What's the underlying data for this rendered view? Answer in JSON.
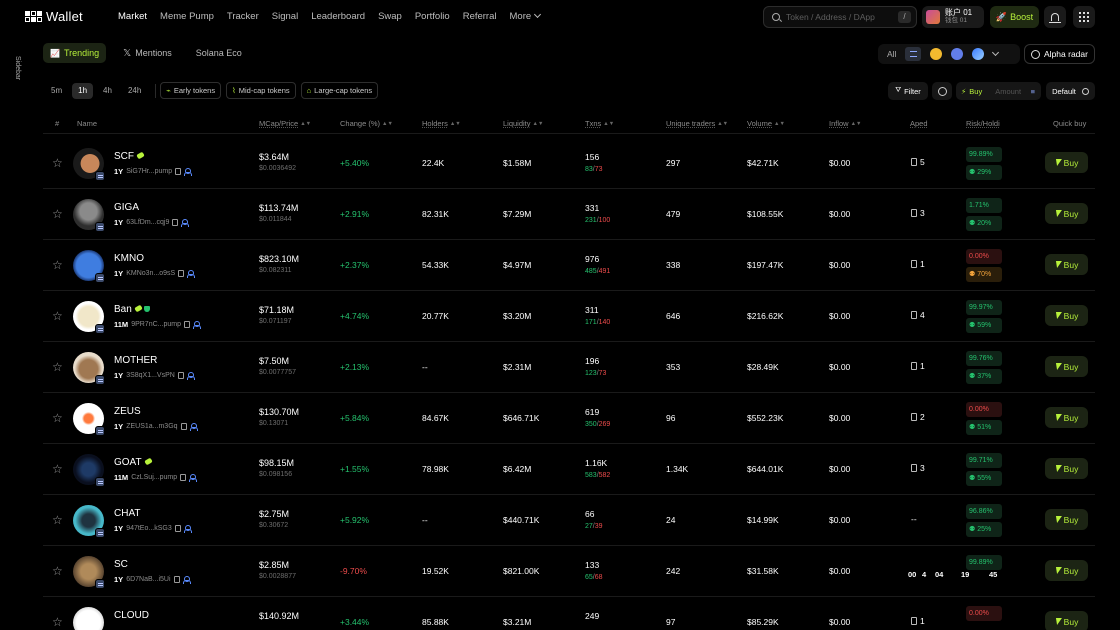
{
  "brand": {
    "logo_text": "Wallet"
  },
  "nav": [
    "Market",
    "Meme Pump",
    "Tracker",
    "Signal",
    "Leaderboard",
    "Swap",
    "Portfolio",
    "Referral",
    "More"
  ],
  "nav_active": "Market",
  "search": {
    "placeholder": "Token / Address / DApp",
    "shortcut": "/"
  },
  "account": {
    "name": "账户 01",
    "sub": "钱包 01"
  },
  "boost_label": "Boost",
  "sidebar_label": "Sidebar",
  "tabs": [
    "Trending",
    "Mentions",
    "Solana Eco"
  ],
  "chain_filter": {
    "all": "All"
  },
  "alpha_radar": "Alpha radar",
  "timeframes": [
    "5m",
    "1h",
    "4h",
    "24h"
  ],
  "timeframe_active": "1h",
  "chips": [
    "Early tokens",
    "Mid-cap tokens",
    "Large-cap tokens"
  ],
  "controls": {
    "filter": "Filter",
    "buy": "Buy",
    "amount": "Amount",
    "default": "Default"
  },
  "columns": [
    "#",
    "Name",
    "MCap/Price",
    "Change (%)",
    "Holders",
    "Liquidity",
    "Txns",
    "Unique traders",
    "Volume",
    "Inflow",
    "Aped",
    "Risk/Holdi",
    "Quick buy"
  ],
  "buy_label": "Buy",
  "rows": [
    {
      "name": "SCF",
      "age": "1Y",
      "addr": "SiG7Hr...pump",
      "mcap": "$3.64M",
      "price": "$0.0036492",
      "change": "+5.40%",
      "holders": "22.4K",
      "liquidity": "$1.58M",
      "txns": "156",
      "buys": "83",
      "sells": "73",
      "traders": "297",
      "volume": "$42.71K",
      "inflow": "$0.00",
      "aped": "5",
      "risk1": "99.89%",
      "risk2": "29%",
      "risk1_color": "g",
      "risk2_color": "g",
      "tags": [
        "pill"
      ]
    },
    {
      "name": "GIGA",
      "age": "1Y",
      "addr": "63LfDm...cqj9",
      "mcap": "$113.74M",
      "price": "$0.011844",
      "change": "+2.91%",
      "holders": "82.31K",
      "liquidity": "$7.29M",
      "txns": "331",
      "buys": "231",
      "sells": "100",
      "traders": "479",
      "volume": "$108.55K",
      "inflow": "$0.00",
      "aped": "3",
      "risk1": "1.71%",
      "risk2": "20%",
      "risk1_color": "g",
      "risk2_color": "g",
      "tags": []
    },
    {
      "name": "KMNO",
      "age": "1Y",
      "addr": "KMNo3n...o9sS",
      "mcap": "$823.10M",
      "price": "$0.082311",
      "change": "+2.37%",
      "holders": "54.33K",
      "liquidity": "$4.97M",
      "txns": "976",
      "buys": "485",
      "sells": "491",
      "traders": "338",
      "volume": "$197.47K",
      "inflow": "$0.00",
      "aped": "1",
      "risk1": "0.00%",
      "risk2": "70%",
      "risk1_color": "r",
      "risk2_color": "o",
      "tags": []
    },
    {
      "name": "Ban",
      "age": "11M",
      "addr": "9PR7nC...pump",
      "mcap": "$71.18M",
      "price": "$0.071197",
      "change": "+4.74%",
      "holders": "20.77K",
      "liquidity": "$3.20M",
      "txns": "311",
      "buys": "171",
      "sells": "140",
      "traders": "646",
      "volume": "$216.62K",
      "inflow": "$0.00",
      "aped": "4",
      "risk1": "99.97%",
      "risk2": "59%",
      "risk1_color": "g",
      "risk2_color": "g",
      "tags": [
        "pill",
        "shield"
      ]
    },
    {
      "name": "MOTHER",
      "age": "1Y",
      "addr": "3S8qX1...VsPN",
      "mcap": "$7.50M",
      "price": "$0.0077757",
      "change": "+2.13%",
      "holders": "--",
      "liquidity": "$2.31M",
      "txns": "196",
      "buys": "123",
      "sells": "73",
      "traders": "353",
      "volume": "$28.49K",
      "inflow": "$0.00",
      "aped": "1",
      "risk1": "99.76%",
      "risk2": "37%",
      "risk1_color": "g",
      "risk2_color": "g",
      "tags": []
    },
    {
      "name": "ZEUS",
      "age": "1Y",
      "addr": "ZEUS1a...m3Gq",
      "mcap": "$130.70M",
      "price": "$0.13071",
      "change": "+5.84%",
      "holders": "84.67K",
      "liquidity": "$646.71K",
      "txns": "619",
      "buys": "350",
      "sells": "269",
      "traders": "96",
      "volume": "$552.23K",
      "inflow": "$0.00",
      "aped": "2",
      "risk1": "0.00%",
      "risk2": "51%",
      "risk1_color": "r",
      "risk2_color": "g",
      "tags": []
    },
    {
      "name": "GOAT",
      "age": "11M",
      "addr": "CzLSuj...pump",
      "mcap": "$98.15M",
      "price": "$0.098156",
      "change": "+1.55%",
      "holders": "78.98K",
      "liquidity": "$6.42M",
      "txns": "1.16K",
      "buys": "583",
      "sells": "582",
      "traders": "1.34K",
      "volume": "$644.01K",
      "inflow": "$0.00",
      "aped": "3",
      "risk1": "99.71%",
      "risk2": "55%",
      "risk1_color": "g",
      "risk2_color": "g",
      "tags": [
        "pill"
      ]
    },
    {
      "name": "CHAT",
      "age": "1Y",
      "addr": "947tEo...kSG3",
      "mcap": "$2.75M",
      "price": "$0.30672",
      "change": "+5.92%",
      "holders": "--",
      "liquidity": "$440.71K",
      "txns": "66",
      "buys": "27",
      "sells": "39",
      "traders": "24",
      "volume": "$14.99K",
      "inflow": "$0.00",
      "aped": "--",
      "risk1": "96.86%",
      "risk2": "25%",
      "risk1_color": "g",
      "risk2_color": "g",
      "tags": []
    },
    {
      "name": "SC",
      "age": "1Y",
      "addr": "6D7NaB...i5Ui",
      "mcap": "$2.85M",
      "price": "$0.0028877",
      "change": "-9.70%",
      "holders": "19.52K",
      "liquidity": "$821.00K",
      "txns": "133",
      "buys": "65",
      "sells": "68",
      "traders": "242",
      "volume": "$31.58K",
      "inflow": "$0.00",
      "aped": "",
      "risk1": "99.89%",
      "risk2": "",
      "risk1_color": "g",
      "risk2_color": "g",
      "tags": []
    },
    {
      "name": "CLOUD",
      "age": "",
      "addr": "",
      "mcap": "$140.92M",
      "price": "",
      "change": "+3.44%",
      "holders": "85.88K",
      "liquidity": "$3.21M",
      "txns": "249",
      "buys": "",
      "sells": "",
      "traders": "97",
      "volume": "$85.29K",
      "inflow": "$0.00",
      "aped": "1",
      "risk1": "0.00%",
      "risk2": "",
      "risk1_color": "r",
      "risk2_color": "g",
      "tags": []
    }
  ],
  "overlay_digits": [
    "00",
    "4",
    "04",
    "19",
    "45"
  ],
  "colors": {
    "accent": "#b8f23b",
    "up": "#25c26e",
    "down": "#ec4b4b",
    "bg": "#000000"
  }
}
